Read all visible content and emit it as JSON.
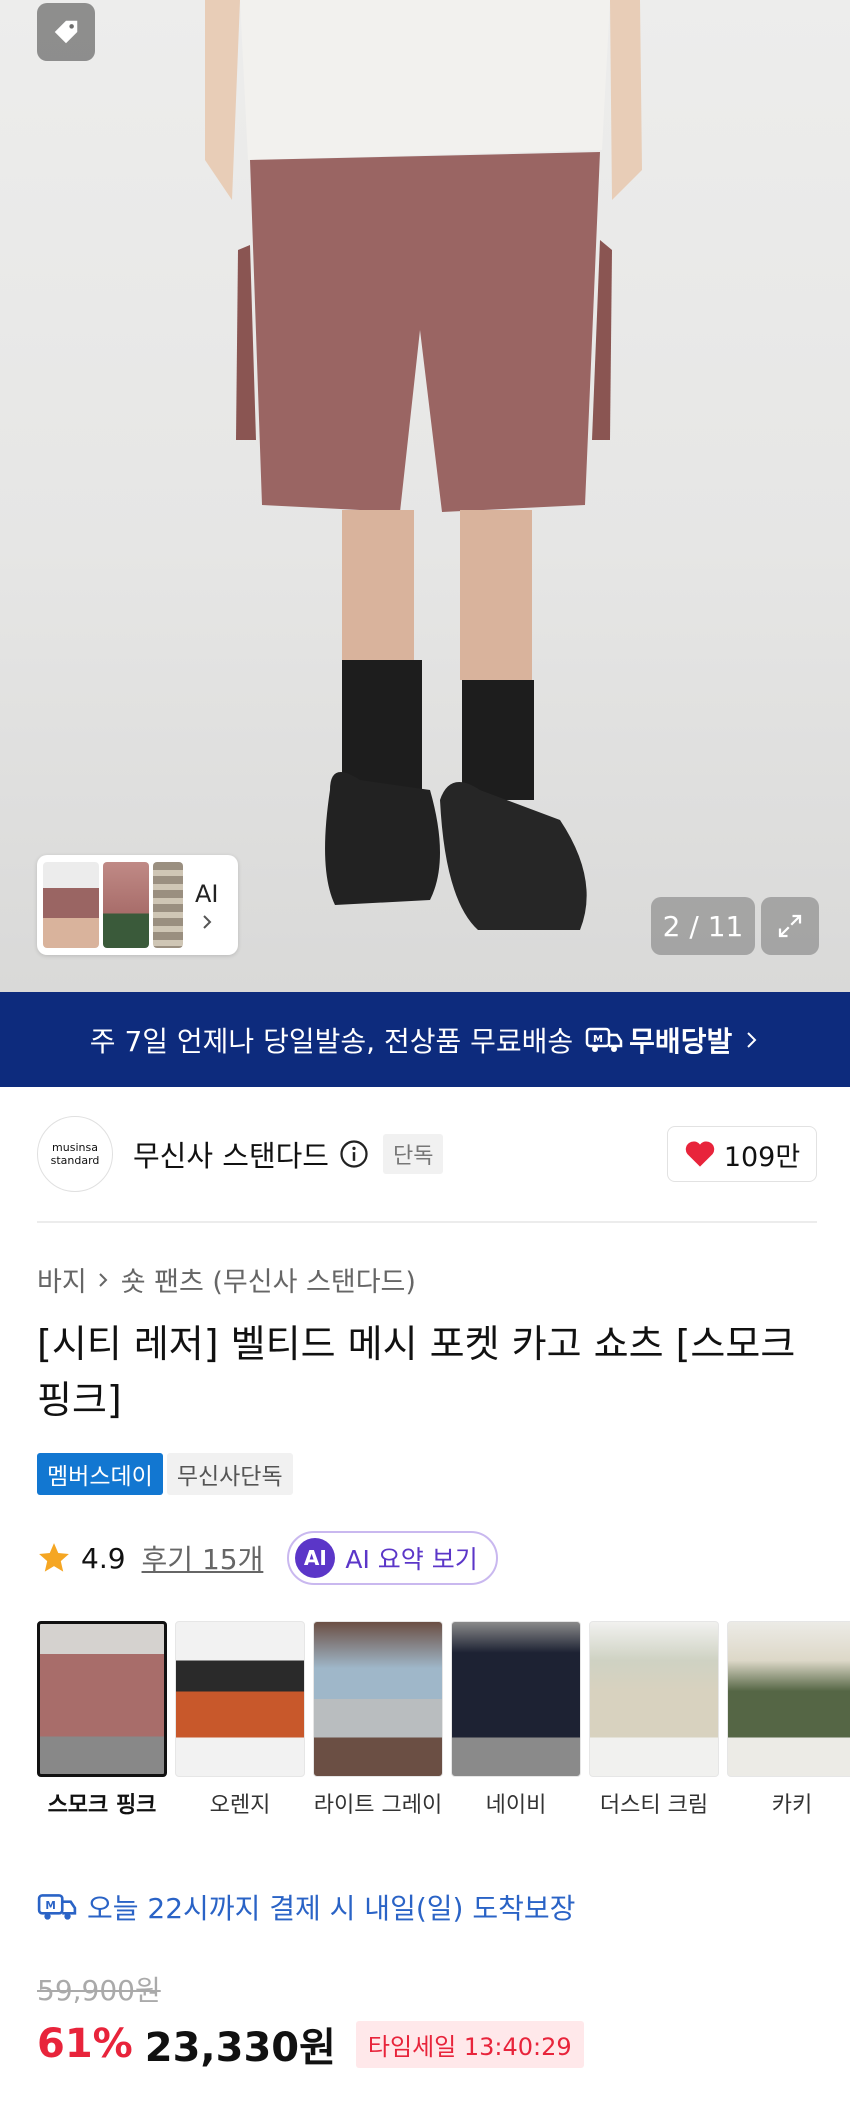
{
  "gallery": {
    "counter": "2 / 11",
    "ai_thumb_label": "AI"
  },
  "banner": {
    "text": "주 7일 언제나 당일발송, 전상품 무료배송",
    "brand": "무배당발"
  },
  "brand": {
    "logo_line1": "musinsa",
    "logo_line2": "standard",
    "name": "무신사 스탠다드",
    "exclusive": "단독",
    "likes": "109만"
  },
  "breadcrumb": {
    "category": "바지",
    "subcategory": "숏 팬츠 (무신사 스탠다드)"
  },
  "product": {
    "title": "[시티 레저] 벨티드 메시 포켓 카고 쇼츠 [스모크 핑크]",
    "badges": [
      "멤버스데이",
      "무신사단독"
    ]
  },
  "rating": {
    "score": "4.9",
    "reviews": "후기 15개",
    "ai_badge": "AI",
    "ai_summary": "AI 요약 보기"
  },
  "colors": [
    {
      "label": "스모크 핑크",
      "swatch": "#a86d6a"
    },
    {
      "label": "오렌지",
      "swatch": "#c8582b"
    },
    {
      "label": "라이트 그레이",
      "swatch": "#b9bdbf"
    },
    {
      "label": "네이비",
      "swatch": "#1d2233"
    },
    {
      "label": "더스티 크림",
      "swatch": "#d8d2bf"
    },
    {
      "label": "카키",
      "swatch": "#556645"
    }
  ],
  "delivery": {
    "text": "오늘 22시까지 결제 시 내일(일) 도착보장"
  },
  "price": {
    "original": "59,900원",
    "discount": "61%",
    "sale": "23,330원",
    "timesale": "타임세일 13:40:29"
  },
  "theme": {
    "accent_navy": "#0d2b7d",
    "accent_red": "#e8243b",
    "accent_blue": "#2a63c6",
    "badge_blue": "#1277d1",
    "ai_purple": "#5b36c8"
  }
}
